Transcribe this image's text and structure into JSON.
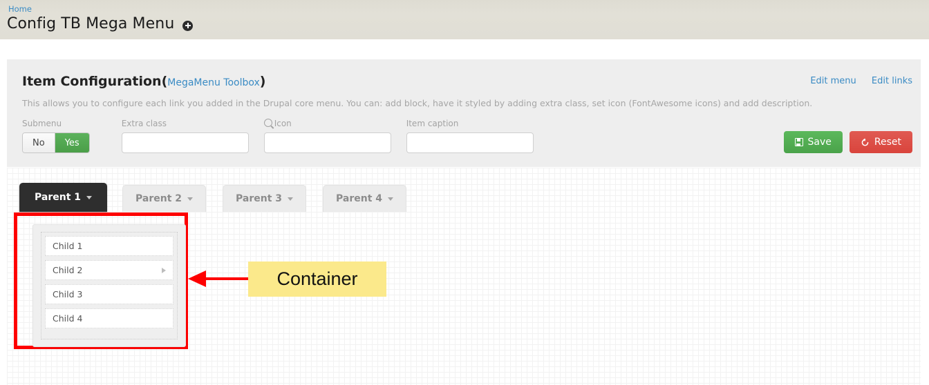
{
  "topbar": {
    "breadcrumb": "Home",
    "page_title": "Config TB Mega Menu",
    "add_icon": "plus-circle-icon"
  },
  "panel": {
    "title": "Item Configuration",
    "paren_open": "(",
    "toolbox_link": "MegaMenu Toolbox",
    "paren_close": ")",
    "description": "This allows you to configure each link you added in the Drupal core menu. You can: add block, have it styled by adding extra class, set icon (FontAwesome icons) and add description.",
    "actions": {
      "edit_menu": "Edit menu",
      "edit_links": "Edit links"
    },
    "form": {
      "submenu": {
        "label": "Submenu",
        "option_no": "No",
        "option_yes": "Yes",
        "selected": "Yes"
      },
      "extra_class": {
        "label": "Extra class",
        "value": "",
        "placeholder": ""
      },
      "icon": {
        "label": "Icon",
        "icon_glyph": "search-icon",
        "value": "",
        "placeholder": ""
      },
      "item_caption": {
        "label": "Item caption",
        "value": "",
        "placeholder": ""
      }
    },
    "buttons": {
      "save": "Save",
      "save_icon": "floppy-disk-icon",
      "reset": "Reset",
      "reset_icon": "undo-arrow-icon"
    }
  },
  "canvas": {
    "tabs": [
      {
        "label": "Parent 1",
        "active": true
      },
      {
        "label": "Parent 2",
        "active": false
      },
      {
        "label": "Parent 3",
        "active": false
      },
      {
        "label": "Parent 4",
        "active": false
      }
    ],
    "children": [
      {
        "label": "Child 1",
        "has_submenu": false
      },
      {
        "label": "Child 2",
        "has_submenu": true
      },
      {
        "label": "Child 3",
        "has_submenu": false
      },
      {
        "label": "Child 4",
        "has_submenu": false
      }
    ],
    "annotation": {
      "label": "Container",
      "highlight_color": "#fe0000",
      "label_bg": "#fbe98b"
    }
  },
  "colors": {
    "topbar_bg": "#e0ded5",
    "link_blue": "#3a8bc4",
    "panel_bg": "#eeeeee",
    "green": "#4a9e48",
    "red": "#d9443c",
    "active_tab": "#2e2e2e"
  }
}
